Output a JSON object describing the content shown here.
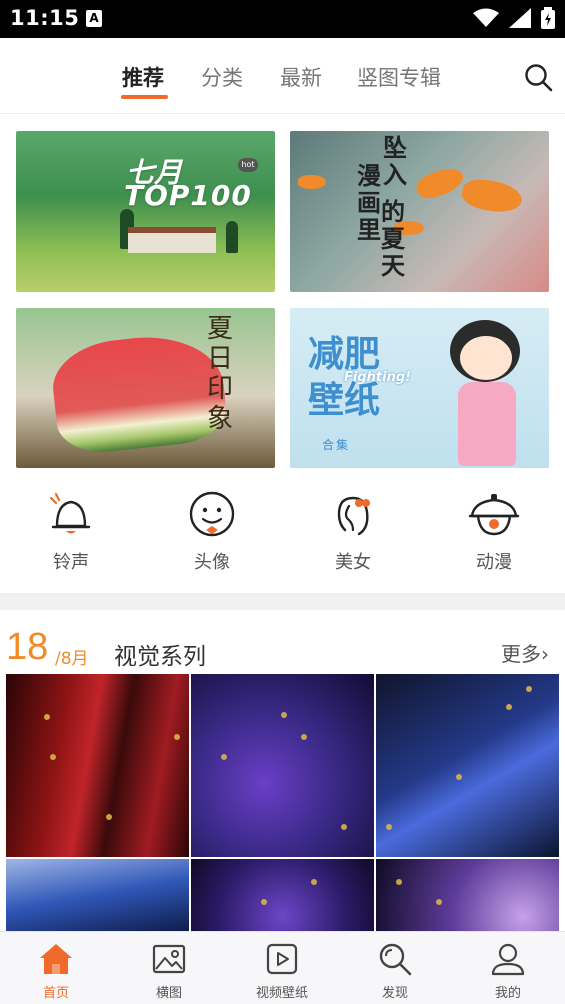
{
  "status_bar": {
    "time": "11:15"
  },
  "top_nav": {
    "tabs": [
      {
        "label": "推荐",
        "active": true
      },
      {
        "label": "分类",
        "active": false
      },
      {
        "label": "最新",
        "active": false
      },
      {
        "label": "竖图专辑",
        "active": false
      }
    ]
  },
  "banners": {
    "b1": {
      "line1": "七月",
      "line2": "TOP100",
      "badge": "hot"
    },
    "b2": {
      "col1": "坠入",
      "col2": "漫画里",
      "col3": "的夏天"
    },
    "b3": {
      "text": "夏日印象"
    },
    "b4": {
      "title": "减肥壁纸",
      "sub": "Fighting!",
      "tag": "合集"
    }
  },
  "categories": [
    {
      "label": "铃声",
      "icon": "bell-icon"
    },
    {
      "label": "头像",
      "icon": "face-icon"
    },
    {
      "label": "美女",
      "icon": "girl-icon"
    },
    {
      "label": "动漫",
      "icon": "anime-icon"
    }
  ],
  "section": {
    "day": "18",
    "month": "/8月",
    "title": "视觉系列",
    "more": "更多›"
  },
  "bottom_nav": [
    {
      "label": "首页",
      "icon": "home-icon",
      "active": true
    },
    {
      "label": "横图",
      "icon": "image-icon",
      "active": false
    },
    {
      "label": "视频壁纸",
      "icon": "video-icon",
      "active": false
    },
    {
      "label": "发现",
      "icon": "search-icon",
      "active": false
    },
    {
      "label": "我的",
      "icon": "user-icon",
      "active": false
    }
  ],
  "colors": {
    "accent": "#f06a2a",
    "date": "#f28a2a"
  }
}
